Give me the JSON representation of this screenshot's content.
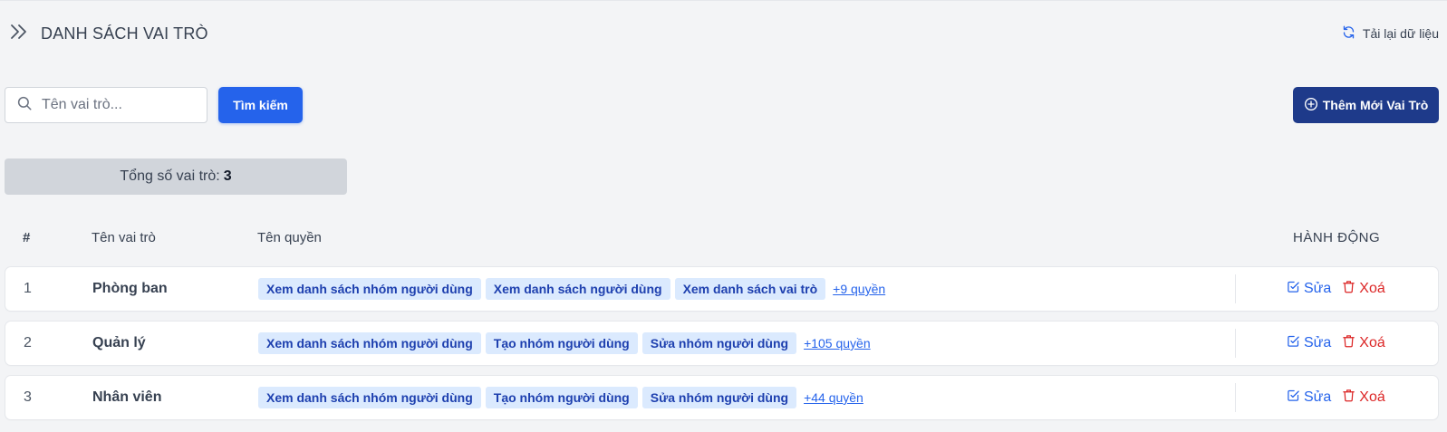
{
  "header": {
    "title": "DANH SÁCH VAI TRÒ",
    "reload_label": "Tải lại dữ liệu"
  },
  "search": {
    "placeholder": "Tên vai trò...",
    "value": "",
    "button_label": "Tìm kiếm"
  },
  "add_button_label": "Thêm Mới Vai Trò",
  "summary": {
    "label": "Tổng số vai trò:",
    "count": "3"
  },
  "table": {
    "headers": {
      "index": "#",
      "name": "Tên vai trò",
      "permissions": "Tên quyền",
      "actions": "HÀNH ĐỘNG"
    },
    "edit_label": "Sửa",
    "delete_label": "Xoá",
    "rows": [
      {
        "index": "1",
        "name": "Phòng ban",
        "permissions": [
          "Xem danh sách nhóm người dùng",
          "Xem danh sách người dùng",
          "Xem danh sách vai trò"
        ],
        "more": "+9 quyền"
      },
      {
        "index": "2",
        "name": "Quản lý",
        "permissions": [
          "Xem danh sách nhóm người dùng",
          "Tạo nhóm người dùng",
          "Sửa nhóm người dùng"
        ],
        "more": "+105 quyền"
      },
      {
        "index": "3",
        "name": "Nhân viên",
        "permissions": [
          "Xem danh sách nhóm người dùng",
          "Tạo nhóm người dùng",
          "Sửa nhóm người dùng"
        ],
        "more": "+44 quyền"
      }
    ]
  },
  "icons": {
    "toggle": "double-chevron-right-icon",
    "reload": "refresh-icon",
    "search": "search-icon",
    "add": "plus-circle-icon",
    "edit": "edit-icon",
    "delete": "trash-icon"
  },
  "colors": {
    "primary": "#2563eb",
    "add_button": "#1e3a8a",
    "tag_bg": "#dbeafe",
    "tag_text": "#1e40af",
    "danger": "#dc2626",
    "total_bg": "#d1d5db",
    "page_bg": "#f3f4f6"
  }
}
